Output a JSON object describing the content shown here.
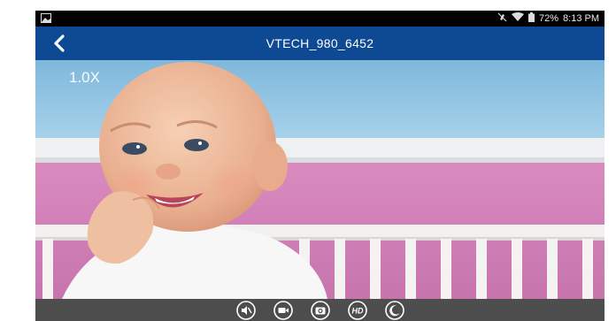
{
  "status_bar": {
    "battery_text": "72%",
    "time": "8:13 PM",
    "icons": [
      "gallery-icon",
      "mute-icon",
      "wifi-icon",
      "battery-icon"
    ]
  },
  "header": {
    "title": "VTECH_980_6452",
    "back_icon": "back-chevron-icon",
    "color": "#0d4a93"
  },
  "camera": {
    "zoom_label": "1.0X"
  },
  "controls": {
    "buttons": [
      {
        "name": "mute-speaker-button",
        "icon": "speaker-mute-icon"
      },
      {
        "name": "record-video-button",
        "icon": "video-camera-icon"
      },
      {
        "name": "snapshot-button",
        "icon": "photo-camera-icon"
      },
      {
        "name": "hd-toggle-button",
        "icon": "hd-icon",
        "label": "HD"
      },
      {
        "name": "night-mode-button",
        "icon": "moon-icon"
      }
    ]
  }
}
